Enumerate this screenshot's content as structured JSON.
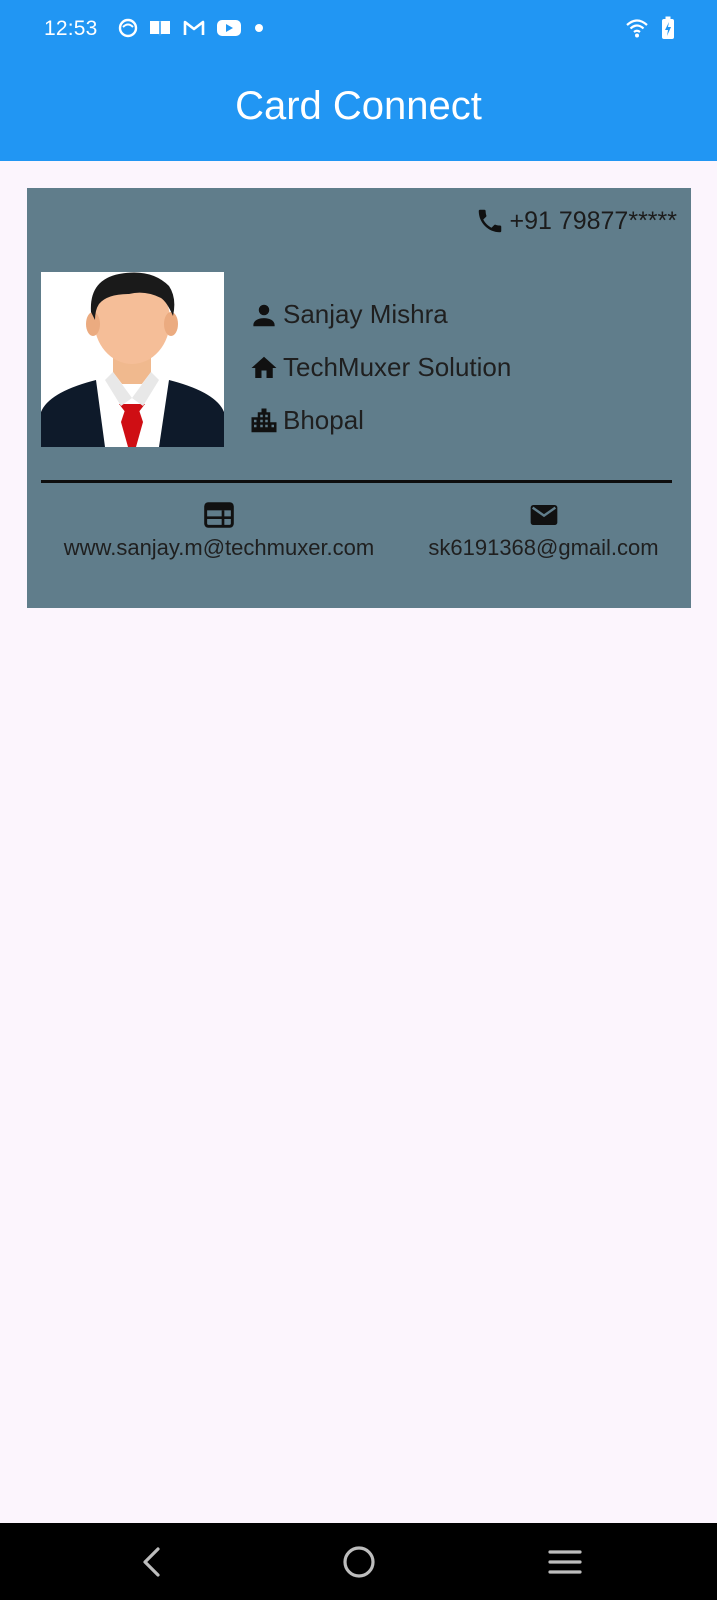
{
  "status_bar": {
    "time": "12:53",
    "icons": [
      "app-circle-icon",
      "book-icon",
      "gmail-icon",
      "youtube-icon",
      "dot-icon",
      "wifi-icon",
      "battery-charging-icon"
    ]
  },
  "app_bar": {
    "title": "Card Connect",
    "color": "#2196f3"
  },
  "card": {
    "background": "#607d8b",
    "phone": "+91 79877*****",
    "name": "Sanjay Mishra",
    "company": "TechMuxer Solution",
    "city": "Bhopal",
    "website": "www.sanjay.m@techmuxer.com",
    "email": "sk6191368@gmail.com",
    "icons": {
      "phone": "phone-icon",
      "name": "person-icon",
      "company": "home-icon",
      "city": "city-building-icon",
      "website": "web-icon",
      "email": "email-icon"
    }
  },
  "nav_bar": {
    "buttons": [
      "back-icon",
      "home-circle-icon",
      "menu-icon"
    ]
  }
}
